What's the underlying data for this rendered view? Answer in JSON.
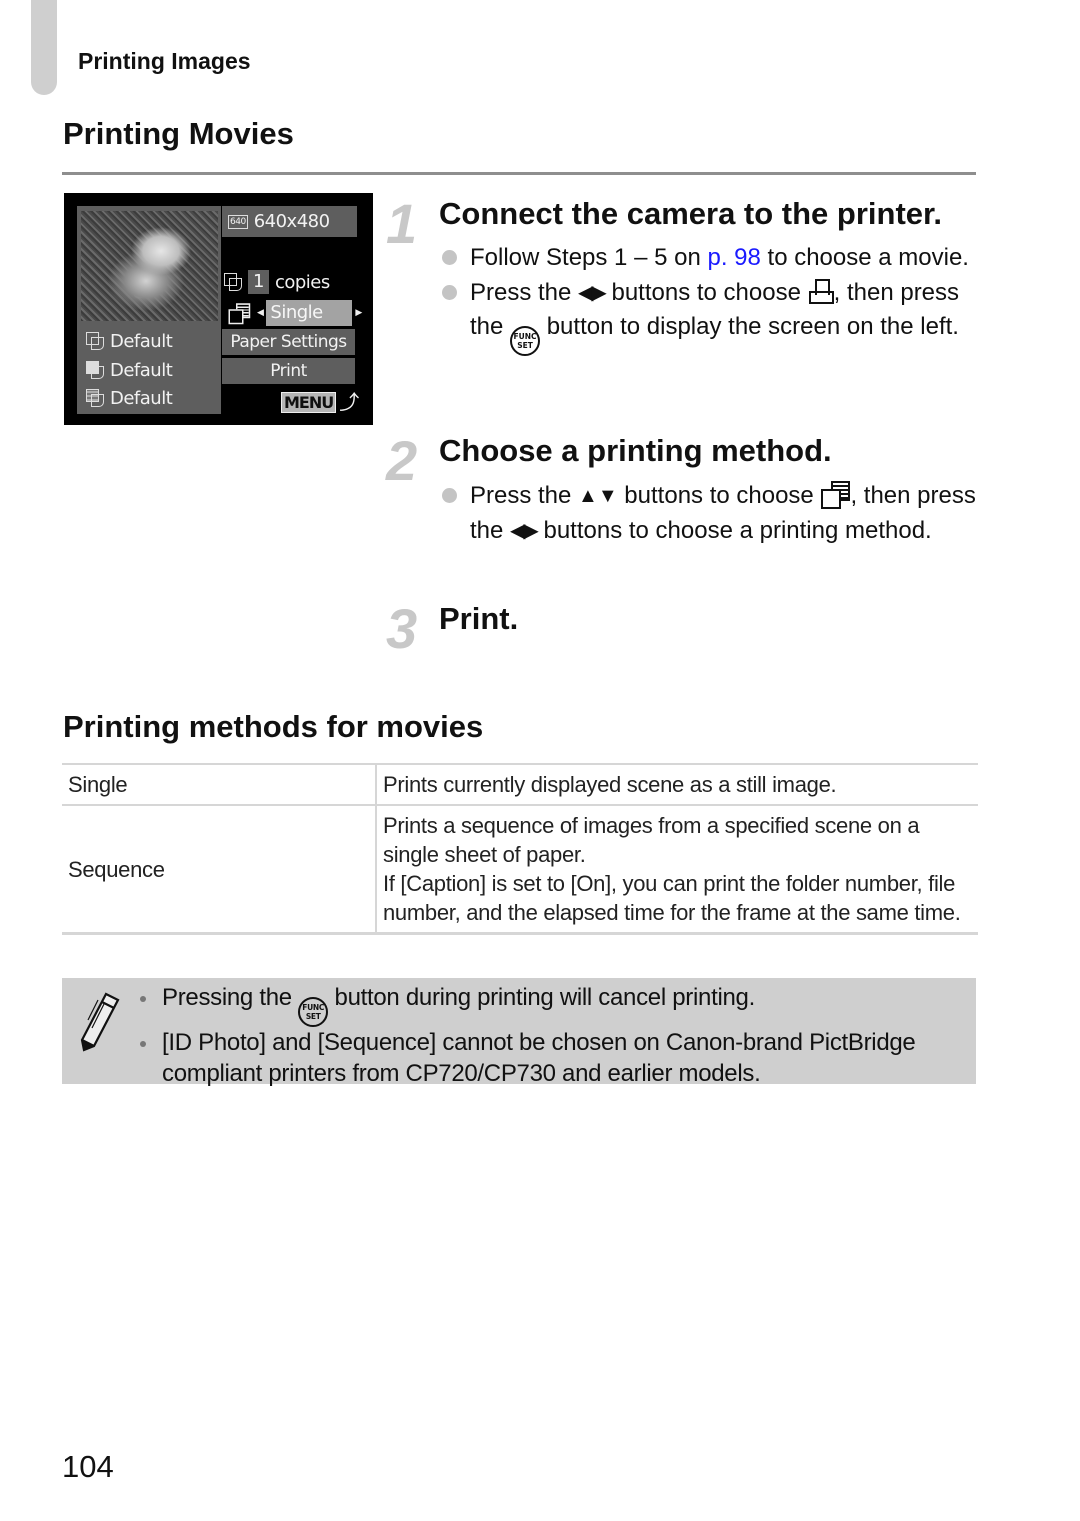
{
  "header": {
    "section_label": "Printing Images"
  },
  "page_title": "Printing Movies",
  "camera_screen": {
    "resolution_icon": "640",
    "resolution": "640x480",
    "copies_value": "1",
    "copies_label": "copies",
    "method_value": "Single",
    "paper_settings": "Paper Settings",
    "print": "Print",
    "menu_label": "MENU",
    "return_icon": "⤴",
    "defaults": [
      "Default",
      "Default",
      "Default"
    ],
    "left_arrow": "◀",
    "right_arrow": "▶"
  },
  "steps": [
    {
      "number": "1",
      "heading": "Connect the camera to the printer.",
      "bullets": [
        {
          "parts": {
            "a": "Follow Steps 1 – 5 on ",
            "link": "p. 98",
            "b": " to choose a movie."
          }
        },
        {
          "parts": {
            "a": "Press the ",
            "arrows": "◀▶",
            "b": " buttons to choose ",
            "c": ", then press the ",
            "func_top": "FUNC",
            "func_bottom": "SET",
            "d": " button to display the screen on the left."
          }
        }
      ]
    },
    {
      "number": "2",
      "heading": "Choose a printing method.",
      "bullets": [
        {
          "parts": {
            "a": "Press the ",
            "arrows_ud": "▲▼",
            "b": " buttons to choose ",
            "c": ", then press the ",
            "arrows_lr": "◀▶",
            "d": " buttons to choose a printing method."
          }
        }
      ]
    },
    {
      "number": "3",
      "heading": "Print."
    }
  ],
  "methods_section": {
    "title": "Printing methods for movies",
    "rows": [
      {
        "term": "Single",
        "description": [
          "Prints currently displayed scene as a still image."
        ]
      },
      {
        "term": "Sequence",
        "description": [
          "Prints a sequence of images from a specified scene on a single sheet of paper.",
          "If [Caption] is set to [On], you can print the folder number, file number, and the elapsed time for the frame at the same time."
        ]
      }
    ]
  },
  "notes": {
    "icon": "pencil-icon",
    "items": [
      {
        "a": "Pressing the ",
        "func_top": "FUNC",
        "func_bottom": "SET",
        "b": " button during printing will cancel printing."
      },
      {
        "a": "[ID Photo] and [Sequence] cannot be chosen on Canon-brand PictBridge compliant printers from CP720/CP730 and earlier models."
      }
    ]
  },
  "page_number": "104",
  "colors": {
    "link": "#1a1aff",
    "step_number": "#c8c8c8",
    "note_background": "#cfcfcf",
    "rule": "#8e8e8e"
  }
}
